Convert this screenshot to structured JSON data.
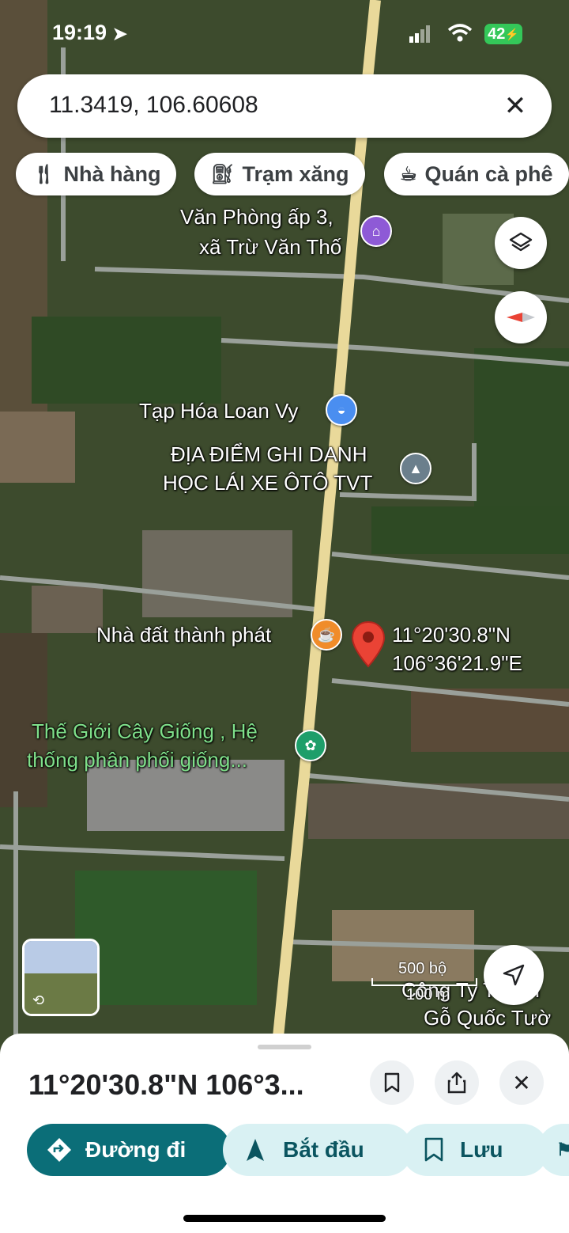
{
  "status_bar": {
    "time": "19:19",
    "battery": "42"
  },
  "search": {
    "value": "11.3419, 106.60608"
  },
  "chips": [
    {
      "label": "Nhà hàng",
      "icon": "fork-knife-icon"
    },
    {
      "label": "Trạm xăng",
      "icon": "gas-pump-icon"
    },
    {
      "label": "Quán cà phê",
      "icon": "coffee-cup-icon"
    }
  ],
  "map": {
    "places": {
      "van_phong_line1": "Văn Phòng ấp 3,",
      "van_phong_line2": "xã Trừ Văn Thố",
      "tap_hoa": "Tạp Hóa Loan Vy",
      "dia_diem_line1": "ĐỊA ĐIỂM GHI DANH",
      "dia_diem_line2": "HỌC LÁI XE ÔTÔ TVT",
      "nha_dat": "Nhà đất thành phát",
      "the_gioi_line1": "Thế Giới Cây Giống , Hệ",
      "the_gioi_line2": "thống phân phối giống...",
      "cong_ty": "Công Ty TNHH",
      "go_quoc": "Gỗ Quốc Tườ"
    },
    "pin": {
      "lat": "11°20'30.8\"N",
      "lng": "106°36'21.9\"E"
    },
    "scale": {
      "imperial": "500 bộ",
      "metric": "100 m"
    },
    "colors": {
      "road": "#e9d99a",
      "pin": "#ea4335"
    }
  },
  "sheet": {
    "title": "11°20'30.8\"N 106°3...",
    "actions": [
      {
        "label": "Đường đi",
        "icon": "directions-icon"
      },
      {
        "label": "Bắt đầu",
        "icon": "navigation-arrow-icon"
      },
      {
        "label": "Lưu",
        "icon": "bookmark-icon"
      }
    ]
  }
}
